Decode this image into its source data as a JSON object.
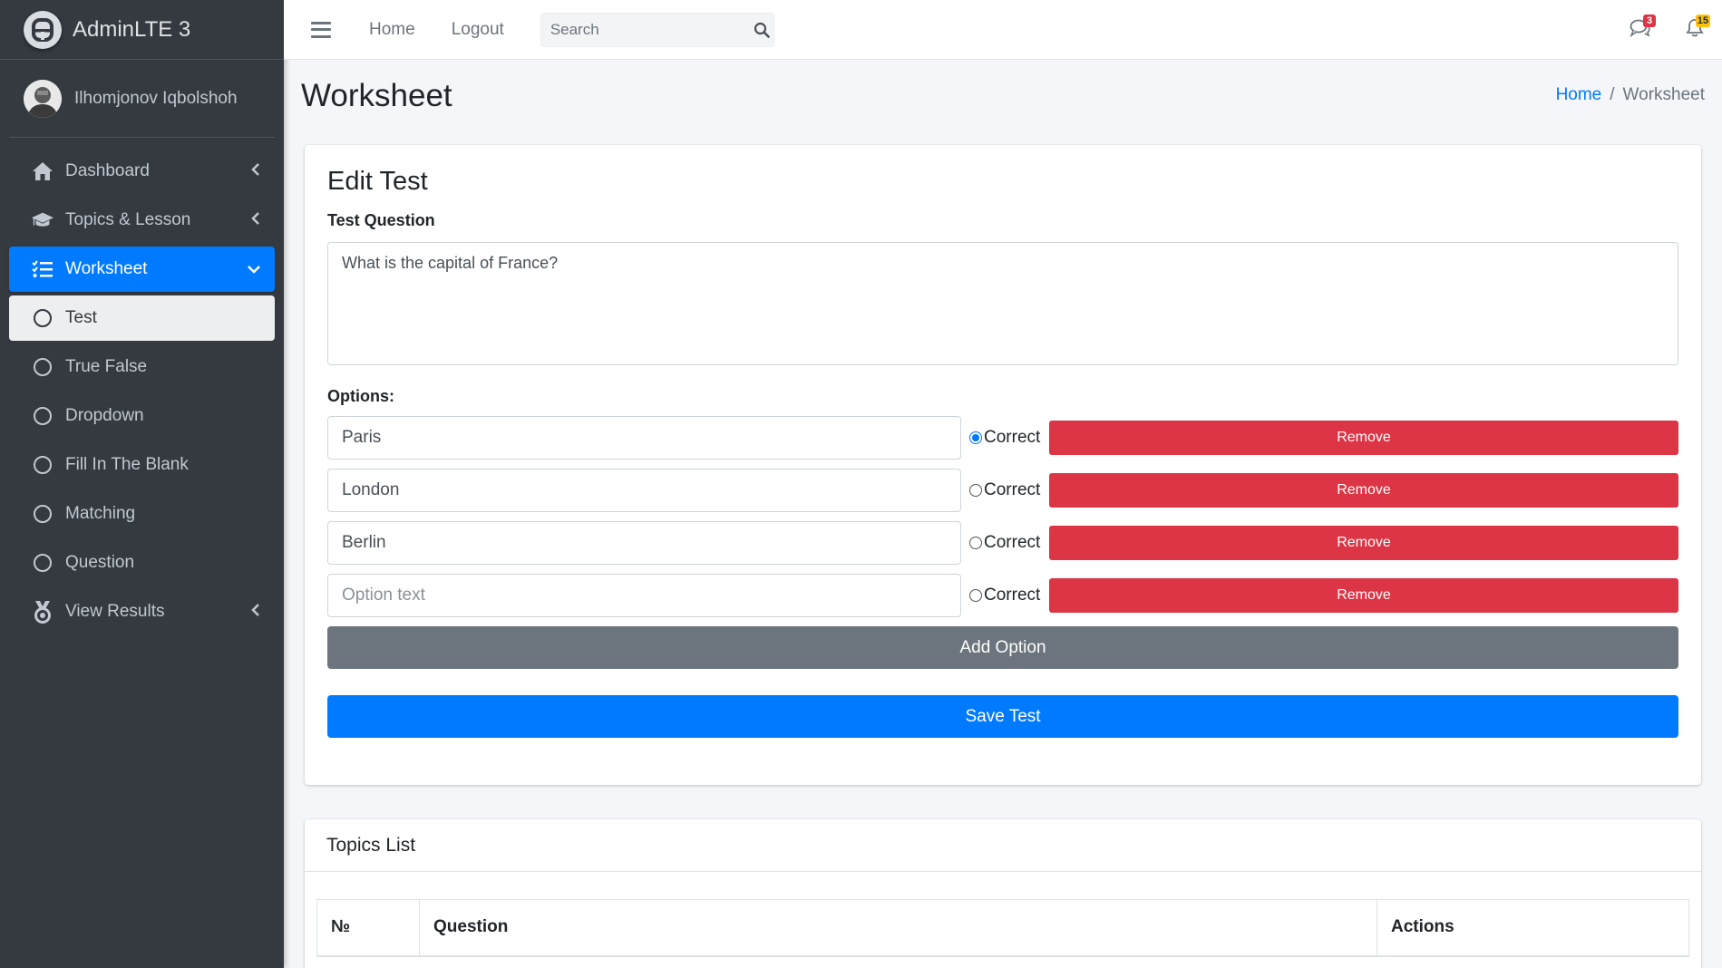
{
  "brand": {
    "name": "AdminLTE 3"
  },
  "user": {
    "name": "Ilhomjonov Iqbolshoh"
  },
  "sidebar": {
    "items": [
      {
        "label": "Dashboard",
        "icon": "home-icon",
        "state": "collapsed"
      },
      {
        "label": "Topics & Lesson",
        "icon": "graduation-cap-icon",
        "state": "collapsed"
      },
      {
        "label": "Worksheet",
        "icon": "tasks-icon",
        "state": "active-expanded"
      },
      {
        "label": "Test",
        "icon": "circle-icon",
        "state": "selected-subitem"
      },
      {
        "label": "True False",
        "icon": "circle-icon"
      },
      {
        "label": "Dropdown",
        "icon": "circle-icon"
      },
      {
        "label": "Fill In The Blank",
        "icon": "circle-icon"
      },
      {
        "label": "Matching",
        "icon": "circle-icon"
      },
      {
        "label": "Question",
        "icon": "circle-icon"
      },
      {
        "label": "View Results",
        "icon": "medal-icon",
        "state": "collapsed"
      }
    ]
  },
  "topbar": {
    "home": "Home",
    "logout": "Logout",
    "search_placeholder": "Search",
    "messages_count": "3",
    "notifications_count": "15"
  },
  "page": {
    "title": "Worksheet",
    "breadcrumb": {
      "home": "Home",
      "separator": "/",
      "current": "Worksheet"
    }
  },
  "edit_test": {
    "title": "Edit Test",
    "question_label": "Test Question",
    "question_value": "What is the capital of France?",
    "options_label": "Options:",
    "correct_label": "Correct",
    "remove_label": "Remove",
    "option_placeholder": "Option text",
    "options": [
      {
        "value": "Paris",
        "correct": true
      },
      {
        "value": "London",
        "correct": false
      },
      {
        "value": "Berlin",
        "correct": false
      },
      {
        "value": "",
        "correct": false
      }
    ],
    "add_option_label": "Add Option",
    "save_label": "Save Test"
  },
  "topics_list": {
    "title": "Topics List",
    "columns": [
      "№",
      "Question",
      "Actions"
    ]
  },
  "colors": {
    "sidebar_bg": "#343a40",
    "primary": "#007bff",
    "danger": "#dc3545",
    "secondary": "#6c757d",
    "warning": "#ffc107"
  }
}
